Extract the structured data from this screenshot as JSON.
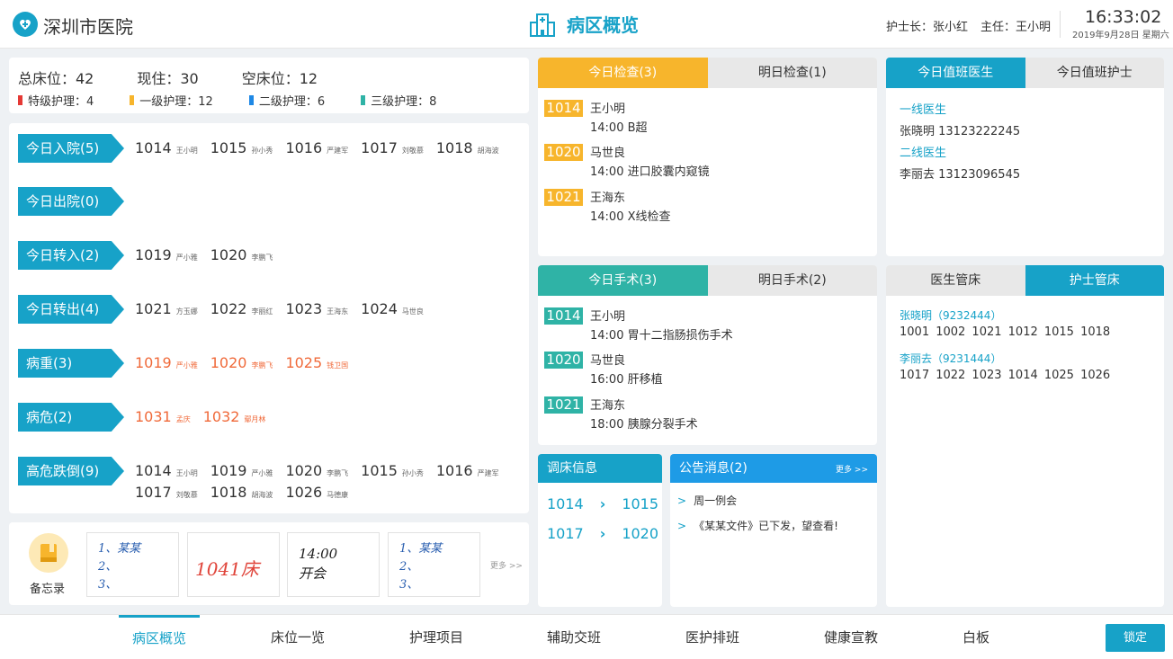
{
  "header": {
    "hospital": "深圳市医院",
    "title": "病区概览",
    "head_nurse": "护士长：张小红",
    "director": "主任：王小明",
    "time": "16:33:02",
    "date": "2019年9月28日 星期六"
  },
  "bed_stats": {
    "total": "总床位：42",
    "occupied": "现住：30",
    "empty": "空床位：12",
    "levels": [
      {
        "label": "特级护理：4",
        "color": "#e53935"
      },
      {
        "label": "一级护理：12",
        "color": "#f7b52c"
      },
      {
        "label": "二级护理：6",
        "color": "#1e88e5"
      },
      {
        "label": "三级护理：8",
        "color": "#2fb3a6"
      }
    ]
  },
  "categories": [
    {
      "label": "今日入院(5)",
      "entries": [
        {
          "bed": "1014",
          "name": "王小明"
        },
        {
          "bed": "1015",
          "name": "孙小秀"
        },
        {
          "bed": "1016",
          "name": "严建军"
        },
        {
          "bed": "1017",
          "name": "刘敬慕"
        },
        {
          "bed": "1018",
          "name": "胡海波"
        }
      ]
    },
    {
      "label": "今日出院(0)",
      "entries": []
    },
    {
      "label": "今日转入(2)",
      "entries": [
        {
          "bed": "1019",
          "name": "严小雅"
        },
        {
          "bed": "1020",
          "name": "李鹏飞"
        }
      ]
    },
    {
      "label": "今日转出(4)",
      "entries": [
        {
          "bed": "1021",
          "name": "方玉娜"
        },
        {
          "bed": "1022",
          "name": "李丽红"
        },
        {
          "bed": "1023",
          "name": "王海东"
        },
        {
          "bed": "1024",
          "name": "马世良"
        }
      ]
    },
    {
      "label": "病重(3)",
      "red": true,
      "entries": [
        {
          "bed": "1019",
          "name": "严小雅"
        },
        {
          "bed": "1020",
          "name": "李鹏飞"
        },
        {
          "bed": "1025",
          "name": "钱卫国"
        }
      ]
    },
    {
      "label": "病危(2)",
      "red": true,
      "entries": [
        {
          "bed": "1031",
          "name": "孟庆"
        },
        {
          "bed": "1032",
          "name": "鄢月林"
        }
      ]
    },
    {
      "label": "高危跌倒(9)",
      "entries": [
        {
          "bed": "1014",
          "name": "王小明"
        },
        {
          "bed": "1019",
          "name": "严小雅"
        },
        {
          "bed": "1020",
          "name": "李鹏飞"
        },
        {
          "bed": "1015",
          "name": "孙小秀"
        },
        {
          "bed": "1016",
          "name": "严建军"
        },
        {
          "bed": "1017",
          "name": "刘敬慕"
        },
        {
          "bed": "1018",
          "name": "胡海波"
        },
        {
          "bed": "1026",
          "name": "马德康"
        }
      ]
    }
  ],
  "memo": {
    "label": "备忘录",
    "more": "更多 >>",
    "notes": [
      {
        "lines": [
          "1、某某",
          "2、",
          "3、"
        ],
        "color": "#2a5fb0"
      },
      {
        "lines": [
          "1041床"
        ],
        "color": "#e0443a"
      },
      {
        "lines": [
          "14:00",
          "开会"
        ],
        "color": "#222"
      },
      {
        "lines": [
          "1、某某",
          "2、",
          "3、"
        ],
        "color": "#2a5fb0"
      }
    ]
  },
  "exams": {
    "tab_today": "今日检查(3)",
    "tab_tomorrow": "明日检查(1)",
    "items": [
      {
        "bed": "1014",
        "name": "王小明",
        "detail": "14:00  B超"
      },
      {
        "bed": "1020",
        "name": "马世良",
        "detail": "14:00  进口胶囊内窥镜"
      },
      {
        "bed": "1021",
        "name": "王海东",
        "detail": "14:00  X线检查"
      }
    ]
  },
  "surgeries": {
    "tab_today": "今日手术(3)",
    "tab_tomorrow": "明日手术(2)",
    "items": [
      {
        "bed": "1014",
        "name": "王小明",
        "detail": "14:00  胃十二指肠损伤手术"
      },
      {
        "bed": "1020",
        "name": "马世良",
        "detail": "16:00  肝移植"
      },
      {
        "bed": "1021",
        "name": "王海东",
        "detail": "18:00  胰腺分裂手术"
      }
    ]
  },
  "duty": {
    "tab_doctor": "今日值班医生",
    "tab_nurse": "今日值班护士",
    "doctors": [
      {
        "role": "一线医生",
        "info": "张晓明  13123222245"
      },
      {
        "role": "二线医生",
        "info": "李丽去  13123096545"
      }
    ]
  },
  "managers": {
    "tab_doctor": "医生管床",
    "tab_nurse": "护士管床",
    "groups": [
      {
        "name": "张晓明（9232444）",
        "beds": "1001  1002  1021  1012  1015  1018"
      },
      {
        "name": "李丽去（9231444）",
        "beds": "1017  1022  1023  1014  1025  1026"
      }
    ]
  },
  "transfer": {
    "title": "调床信息",
    "rows": [
      {
        "from": "1014",
        "to": "1015"
      },
      {
        "from": "1017",
        "to": "1020"
      }
    ]
  },
  "notices": {
    "title": "公告消息(2)",
    "more": "更多 >>",
    "items": [
      "周一例会",
      "《某某文件》已下发，望查看!"
    ]
  },
  "nav": {
    "items": [
      "病区概览",
      "床位一览",
      "护理项目",
      "辅助交班",
      "医护排班",
      "健康宣教",
      "白板"
    ],
    "active": 0,
    "lock": "锁定"
  }
}
